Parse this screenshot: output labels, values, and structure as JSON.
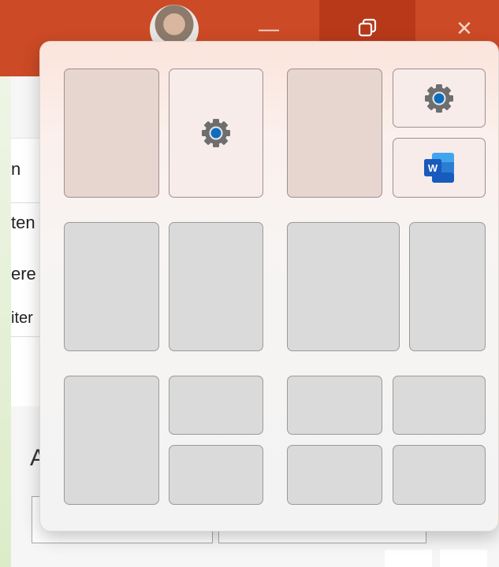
{
  "window": {
    "minimize_glyph": "—",
    "restore_glyph": "⧉",
    "close_glyph": "✕"
  },
  "background_app": {
    "side_fragments": [
      "n",
      "ten",
      "ere",
      "iter"
    ],
    "big_letter": "A"
  },
  "snap_layouts": {
    "icons": [
      "settings-gear-icon",
      "word-icon"
    ],
    "word_letter": "W"
  },
  "colors": {
    "titlebar": "#cc4a25",
    "accent_blue": "#0f6cbd",
    "word_blue": "#185abd"
  }
}
